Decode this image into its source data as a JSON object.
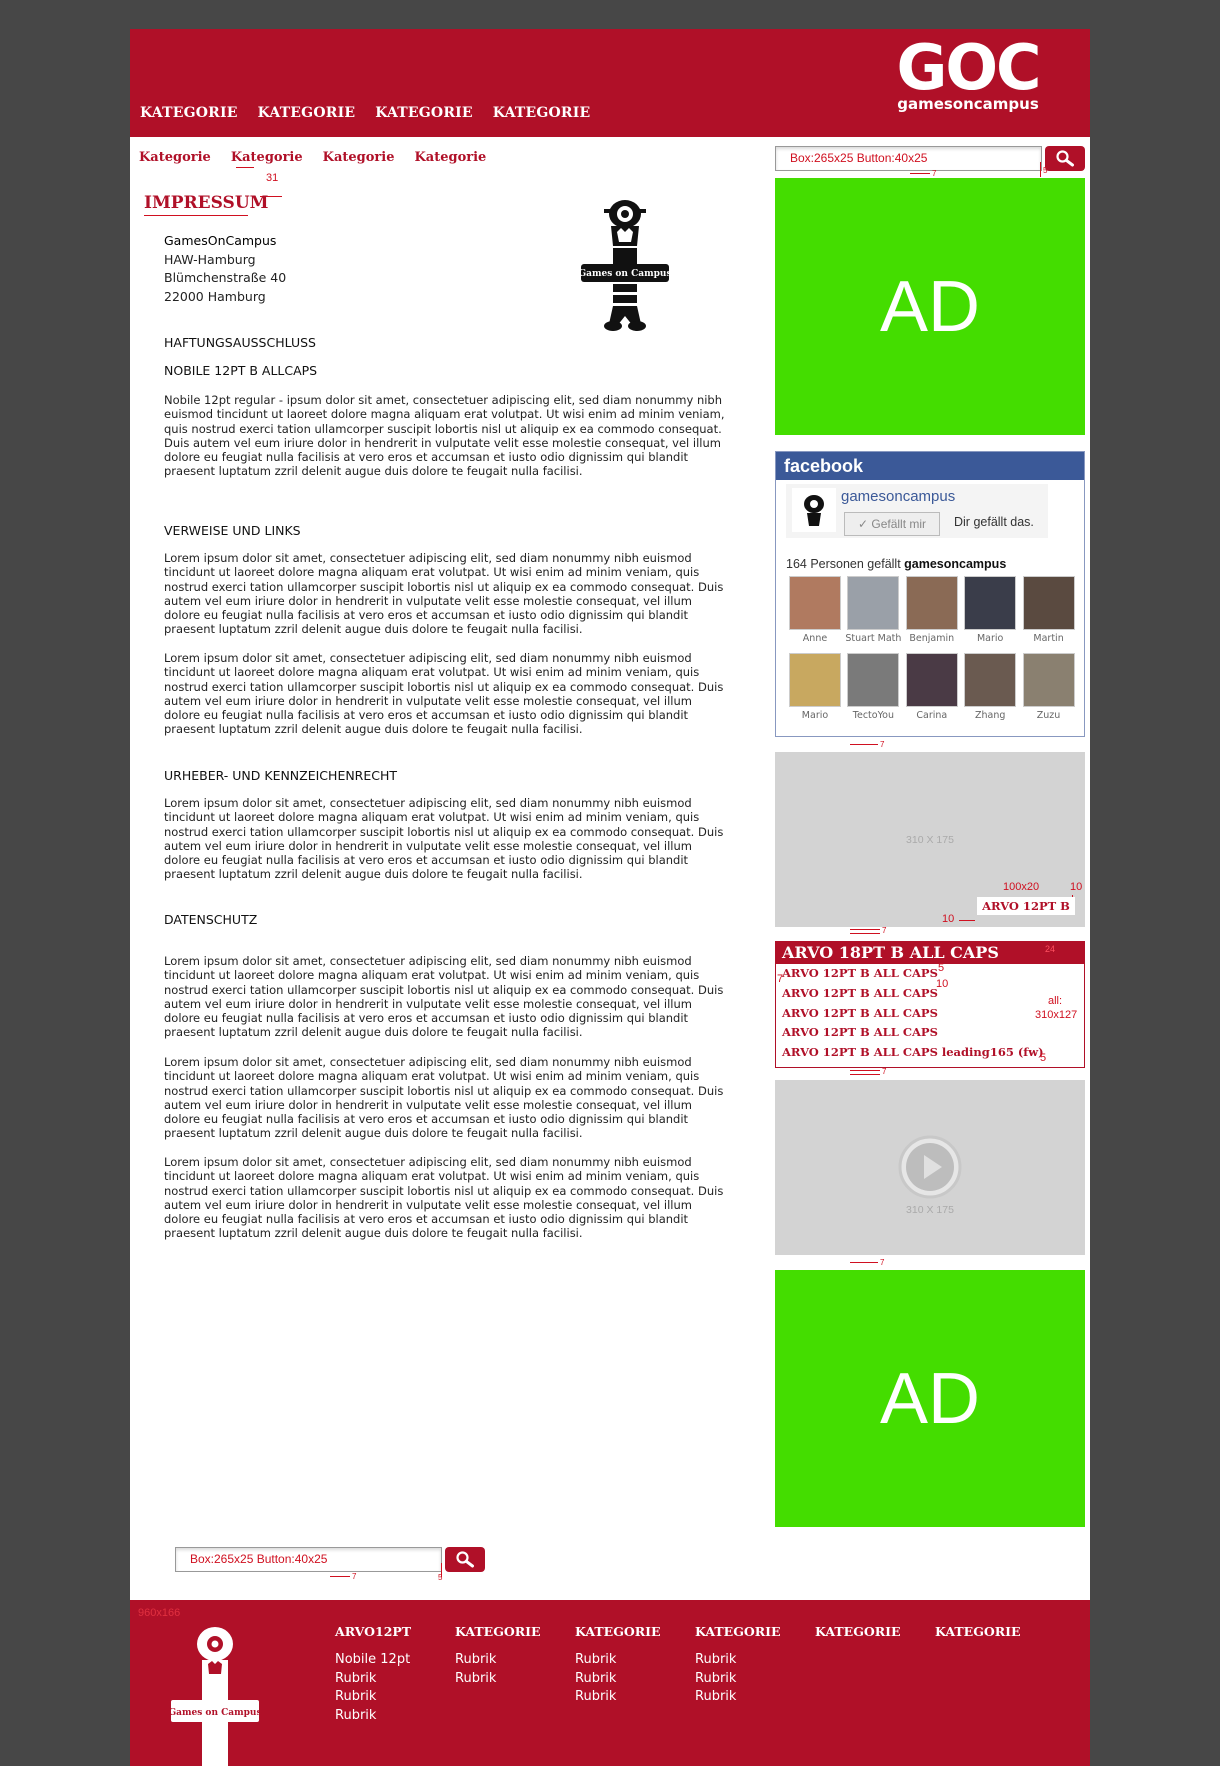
{
  "header": {
    "logo": "GOC",
    "logo_sub": "gamesoncampus",
    "nav": [
      "KATEGORIE",
      "KATEGORIE",
      "KATEGORIE",
      "KATEGORIE"
    ]
  },
  "subnav": [
    "Kategorie",
    "Kategorie",
    "Kategorie",
    "Kategorie"
  ],
  "annotations": {
    "subnav_gap": "31",
    "search_spec": "Box:265x25  Button:40x25",
    "seven": "7",
    "five": "5",
    "ten": "10",
    "tag_size": "100x20",
    "all_label": "all:",
    "all_size": "310x127",
    "footer_size": "960x166",
    "twentyfour": "24"
  },
  "page": {
    "title": "IMPRESSUM",
    "address": [
      "GamesOnCampus",
      "HAW-Hamburg",
      "Blümchenstraße 40",
      "22000 Hamburg"
    ],
    "mascot_label": "Games on Campus",
    "sections": [
      {
        "heading": "HAFTUNGSAUSSCHLUSS"
      },
      {
        "heading": "NOBILE 12PT B ALLCAPS"
      },
      {
        "text": "Nobile 12pt regular - ipsum dolor sit amet, consectetuer adipiscing elit, sed diam nonummy nibh euismod tincidunt ut laoreet dolore magna aliquam erat volutpat. Ut wisi enim ad minim veniam, quis nostrud exerci tation ullamcorper suscipit lobortis nisl ut aliquip ex ea commodo consequat. Duis autem vel eum iriure dolor in hendrerit in vulputate velit esse molestie consequat, vel illum dolore eu feugiat nulla facilisis at vero eros et accumsan et iusto odio dignissim qui blandit praesent luptatum zzril delenit augue duis dolore te feugait nulla facilisi."
      },
      {
        "heading": "VERWEISE UND LINKS"
      },
      {
        "text": "Lorem ipsum dolor sit amet, consectetuer adipiscing elit, sed diam nonummy nibh euismod tincidunt ut laoreet dolore magna aliquam erat volutpat. Ut wisi enim ad minim veniam, quis nostrud exerci tation ullamcorper suscipit lobortis nisl ut aliquip ex ea commodo consequat. Duis autem vel eum iriure dolor in hendrerit in vulputate velit esse molestie consequat, vel illum dolore eu feugiat nulla facilisis at vero eros et accumsan et iusto odio dignissim qui blandit praesent luptatum zzril delenit augue duis dolore te feugait nulla facilisi."
      },
      {
        "text": "Lorem ipsum dolor sit amet, consectetuer adipiscing elit, sed diam nonummy nibh euismod tincidunt ut laoreet dolore magna aliquam erat volutpat. Ut wisi enim ad minim veniam, quis nostrud exerci tation ullamcorper suscipit lobortis nisl ut aliquip ex ea commodo consequat. Duis autem vel eum iriure dolor in hendrerit in vulputate velit esse molestie consequat, vel illum dolore eu feugiat nulla facilisis at vero eros et accumsan et iusto odio dignissim qui blandit praesent luptatum zzril delenit augue duis dolore te feugait nulla facilisi."
      },
      {
        "heading": "URHEBER- UND KENNZEICHENRECHT"
      },
      {
        "text": "Lorem ipsum dolor sit amet, consectetuer adipiscing elit, sed diam nonummy nibh euismod tincidunt ut laoreet dolore magna aliquam erat volutpat. Ut wisi enim ad minim veniam, quis nostrud exerci tation ullamcorper suscipit lobortis nisl ut aliquip ex ea commodo consequat. Duis autem vel eum iriure dolor in hendrerit in vulputate velit esse molestie consequat, vel illum dolore eu feugiat nulla facilisis at vero eros et accumsan et iusto odio dignissim qui blandit praesent luptatum zzril delenit augue duis dolore te feugait nulla facilisi."
      },
      {
        "heading": "DATENSCHUTZ"
      },
      {
        "text": "Lorem ipsum dolor sit amet, consectetuer adipiscing elit, sed diam nonummy nibh euismod tincidunt ut laoreet dolore magna aliquam erat volutpat. Ut wisi enim ad minim veniam, quis nostrud exerci tation ullamcorper suscipit lobortis nisl ut aliquip ex ea commodo consequat. Duis autem vel eum iriure dolor in hendrerit in vulputate velit esse molestie consequat, vel illum dolore eu feugiat nulla facilisis at vero eros et accumsan et iusto odio dignissim qui blandit praesent luptatum zzril delenit augue duis dolore te feugait nulla facilisi."
      },
      {
        "text": "Lorem ipsum dolor sit amet, consectetuer adipiscing elit, sed diam nonummy nibh euismod tincidunt ut laoreet dolore magna aliquam erat volutpat. Ut wisi enim ad minim veniam, quis nostrud exerci tation ullamcorper suscipit lobortis nisl ut aliquip ex ea commodo consequat. Duis autem vel eum iriure dolor in hendrerit in vulputate velit esse molestie consequat, vel illum dolore eu feugiat nulla facilisis at vero eros et accumsan et iusto odio dignissim qui blandit praesent luptatum zzril delenit augue duis dolore te feugait nulla facilisi."
      },
      {
        "text": "Lorem ipsum dolor sit amet, consectetuer adipiscing elit, sed diam nonummy nibh euismod tincidunt ut laoreet dolore magna aliquam erat volutpat. Ut wisi enim ad minim veniam, quis nostrud exerci tation ullamcorper suscipit lobortis nisl ut aliquip ex ea commodo consequat. Duis autem vel eum iriure dolor in hendrerit in vulputate velit esse molestie consequat, vel illum dolore eu feugiat nulla facilisis at vero eros et accumsan et iusto odio dignissim qui blandit praesent luptatum zzril delenit augue duis dolore te feugait nulla facilisi."
      }
    ]
  },
  "sidebar": {
    "ad_label": "AD",
    "facebook": {
      "brand": "facebook",
      "page_name": "gamesoncampus",
      "like_button": "✓ Gefällt mir",
      "likes_text": "Dir gefällt das.",
      "count_prefix": "164 Personen gefällt",
      "count_name": "gamesoncampus",
      "fans": [
        {
          "name": "Anne",
          "color": "#b07a60"
        },
        {
          "name": "Stuart Math",
          "color": "#9aa0a8"
        },
        {
          "name": "Benjamin",
          "color": "#8a6a55"
        },
        {
          "name": "Mario",
          "color": "#3a3d4a"
        },
        {
          "name": "Martin",
          "color": "#5a4a40"
        },
        {
          "name": "Mario",
          "color": "#c8a860"
        },
        {
          "name": "TectoYou",
          "color": "#7a7a7a"
        },
        {
          "name": "Carina",
          "color": "#4a3a45"
        },
        {
          "name": "Zhang",
          "color": "#6a5a50"
        },
        {
          "name": "Zuzu",
          "color": "#8a8070"
        }
      ]
    },
    "placeholder_label": "310 X 175",
    "tag_label": "ARVO 12PT B",
    "list": {
      "header": "ARVO 18PT B ALL CAPS",
      "items": [
        "ARVO 12PT B ALL CAPS",
        "ARVO 12PT B ALL CAPS",
        "ARVO 12PT B ALL CAPS",
        "ARVO 12PT B ALL CAPS",
        "ARVO 12PT B ALL CAPS leading165 (fw)"
      ]
    }
  },
  "footer": {
    "columns": [
      {
        "heading": "ARVO12PT",
        "links": [
          "Nobile 12pt",
          "Rubrik",
          "Rubrik",
          "Rubrik"
        ]
      },
      {
        "heading": "KATEGORIE",
        "links": [
          "Rubrik",
          "Rubrik"
        ]
      },
      {
        "heading": "KATEGORIE",
        "links": [
          "Rubrik",
          "Rubrik",
          "Rubrik"
        ]
      },
      {
        "heading": "KATEGORIE",
        "links": [
          "Rubrik",
          "Rubrik",
          "Rubrik"
        ]
      },
      {
        "heading": "KATEGORIE",
        "links": []
      },
      {
        "heading": "KATEGORIE",
        "links": []
      }
    ],
    "mascot_label": "Games on Campus"
  },
  "colors": {
    "brand_red": "#b01028",
    "ad_green": "#44dd00",
    "page_bg": "#474747",
    "facebook_blue": "#3b5998"
  }
}
